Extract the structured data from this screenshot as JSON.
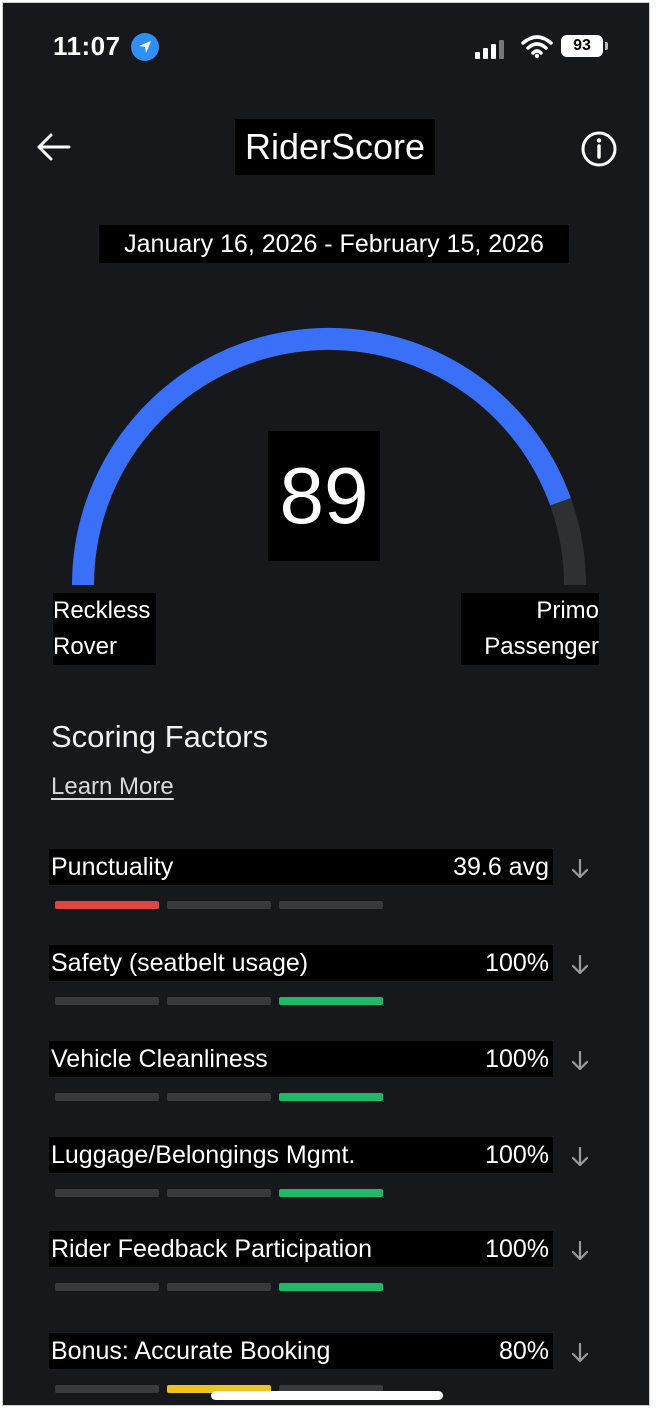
{
  "status_bar": {
    "time": "11:07",
    "battery": "93"
  },
  "header": {
    "title": "RiderScore"
  },
  "period": {
    "date_range": "January 16, 2026 - February 15, 2026"
  },
  "gauge": {
    "score": "89",
    "score_fraction": 0.89,
    "left_label_line1": "Reckless",
    "left_label_line2": "Rover",
    "right_label_line1": "Primo",
    "right_label_line2": "Passenger",
    "fill_color": "#3a6ff7",
    "track_color": "#2f3033"
  },
  "scoring": {
    "title": "Scoring Factors",
    "learn_more": "Learn More",
    "factors": [
      {
        "name": "Punctuality",
        "value": "39.6 avg",
        "level": 1,
        "color": "#e04444"
      },
      {
        "name": "Safety (seatbelt usage)",
        "value": "100%",
        "level": 3,
        "color": "#1fb86a"
      },
      {
        "name": "Vehicle  Cleanliness",
        "value": "100%",
        "level": 3,
        "color": "#1fb86a"
      },
      {
        "name": "Luggage/Belongings Mgmt.",
        "value": "100%",
        "level": 3,
        "color": "#1fb86a"
      },
      {
        "name": "Rider Feedback Participation",
        "value": "100%",
        "level": 3,
        "color": "#1fb86a"
      },
      {
        "name": "Bonus: Accurate Booking",
        "value": "80%",
        "level": 2,
        "color": "#f1c21b"
      }
    ]
  }
}
